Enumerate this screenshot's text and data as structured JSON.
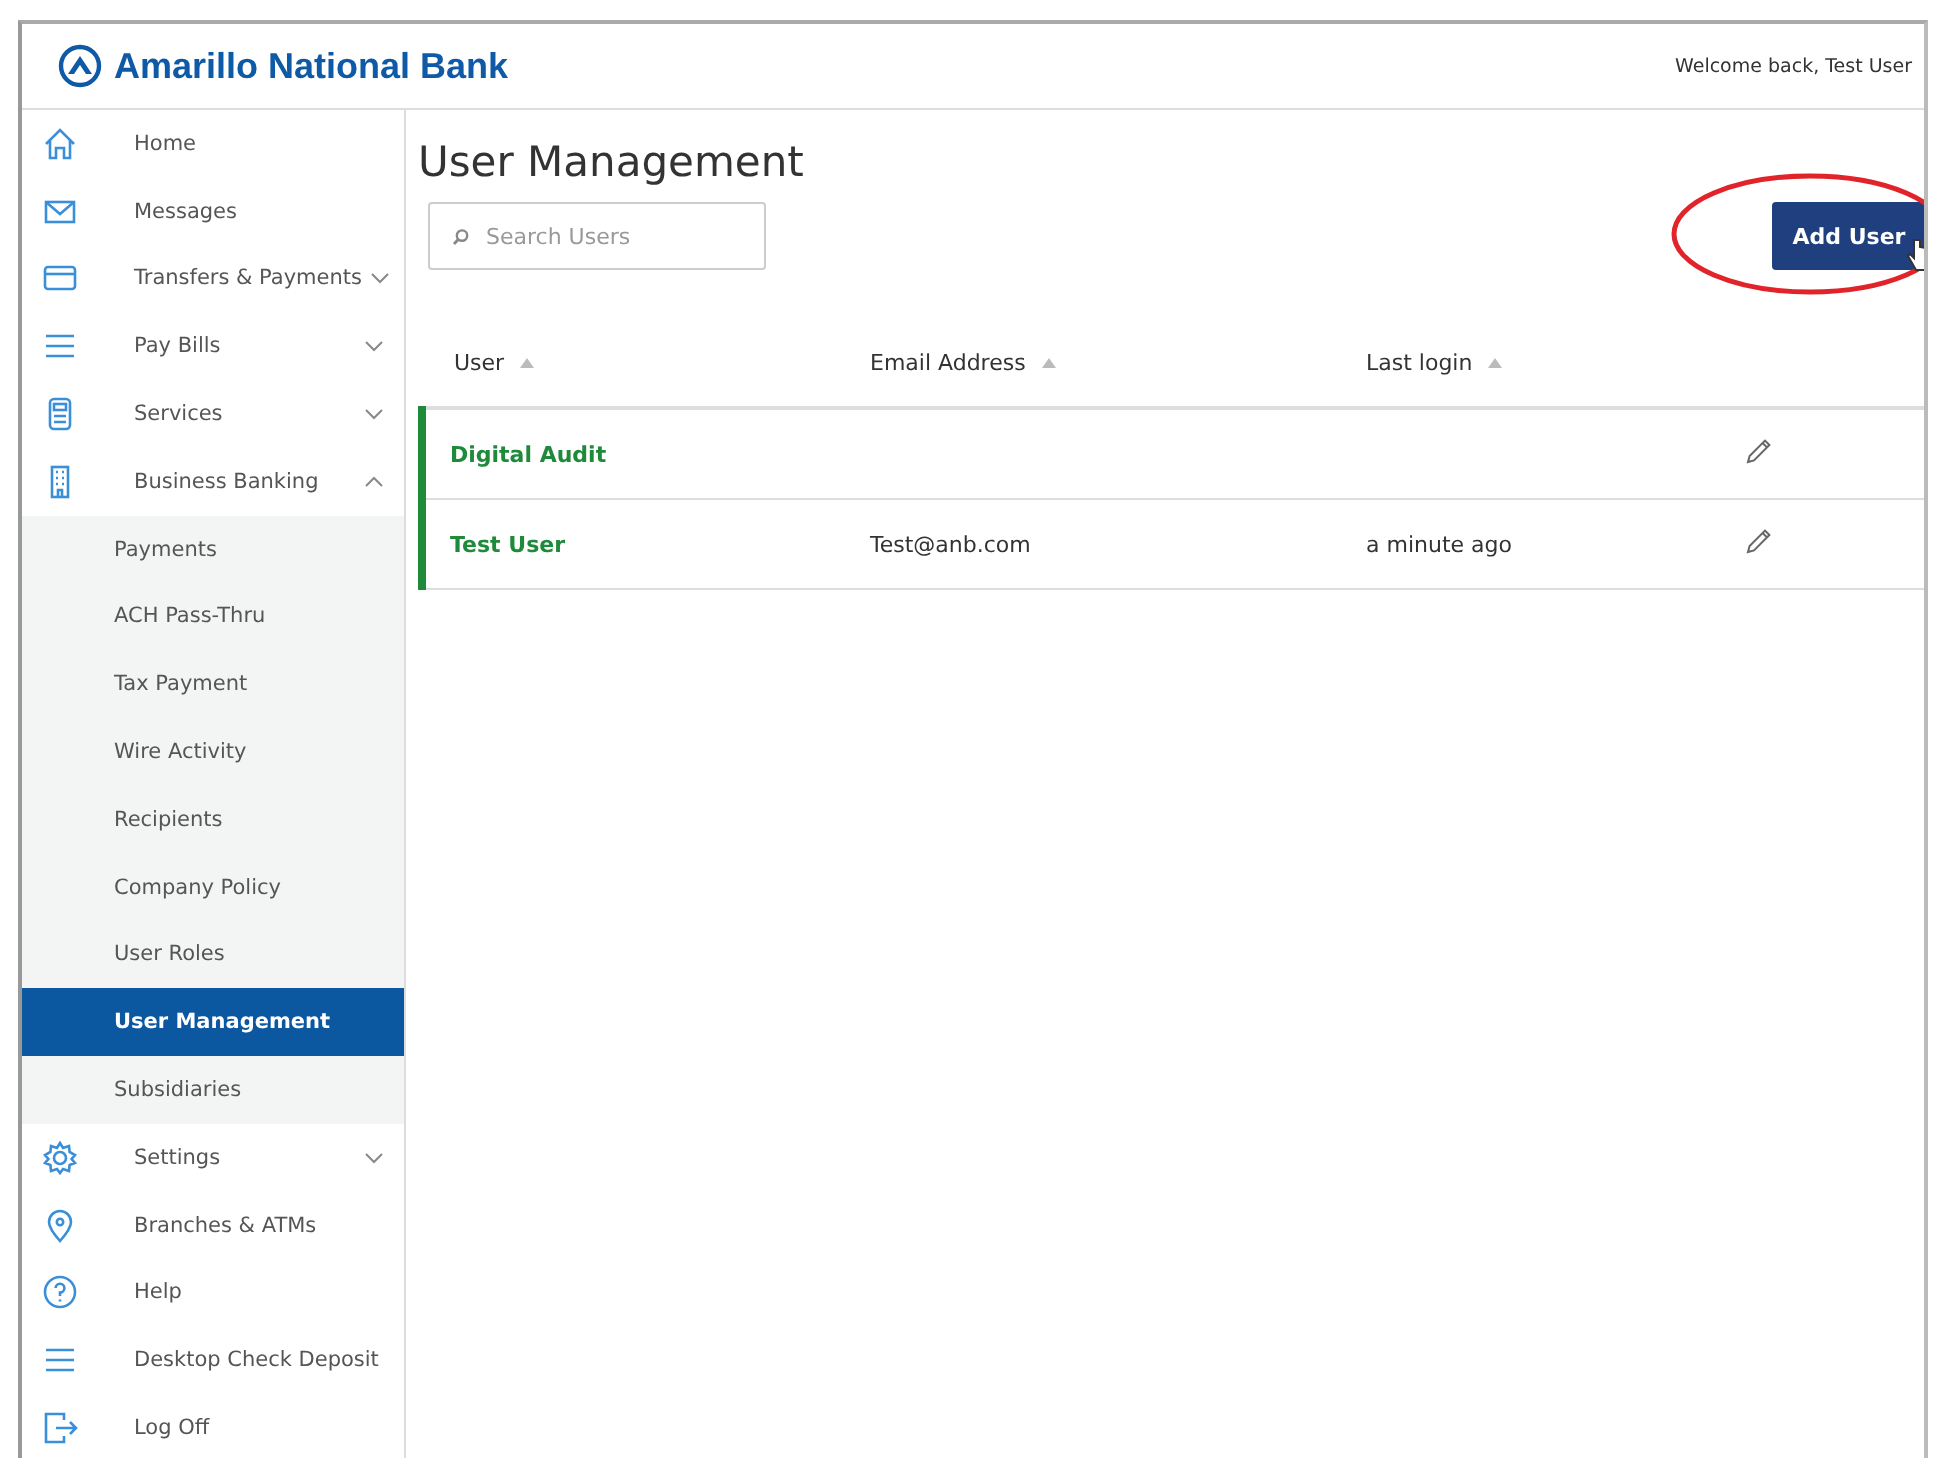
{
  "header": {
    "brand": "Amarillo National Bank",
    "welcome": "Welcome back, Test User"
  },
  "sidebar": {
    "items": [
      {
        "label": "Home",
        "selected": false
      },
      {
        "label": "Messages",
        "selected": false
      },
      {
        "label": "Transfers & Payments",
        "selected": false,
        "expanded": false
      },
      {
        "label": "Pay Bills",
        "selected": false,
        "expanded": false
      },
      {
        "label": "Services",
        "selected": false,
        "expanded": false
      },
      {
        "label": "Business Banking",
        "selected": false,
        "expanded": true,
        "children": [
          {
            "label": "Payments",
            "selected": false
          },
          {
            "label": "ACH Pass-Thru",
            "selected": false
          },
          {
            "label": "Tax Payment",
            "selected": false
          },
          {
            "label": "Wire Activity",
            "selected": false
          },
          {
            "label": "Recipients",
            "selected": false
          },
          {
            "label": "Company Policy",
            "selected": false
          },
          {
            "label": "User Roles",
            "selected": false
          },
          {
            "label": "User Management",
            "selected": true
          },
          {
            "label": "Subsidiaries",
            "selected": false
          }
        ]
      },
      {
        "label": "Settings",
        "selected": false,
        "expanded": false
      },
      {
        "label": "Branches & ATMs",
        "selected": false
      },
      {
        "label": "Help",
        "selected": false
      },
      {
        "label": "Desktop Check Deposit",
        "selected": false
      },
      {
        "label": "Log Off",
        "selected": false
      }
    ]
  },
  "page": {
    "title": "User Management",
    "search": {
      "placeholder": "Search Users"
    },
    "add_button": "Add User",
    "table": {
      "columns": [
        "User",
        "Email Address",
        "Last login"
      ],
      "rows": [
        {
          "user": "Digital Audit",
          "email": "",
          "last_login": ""
        },
        {
          "user": "Test User",
          "email": "Test@anb.com",
          "last_login": "a minute ago"
        }
      ]
    }
  }
}
